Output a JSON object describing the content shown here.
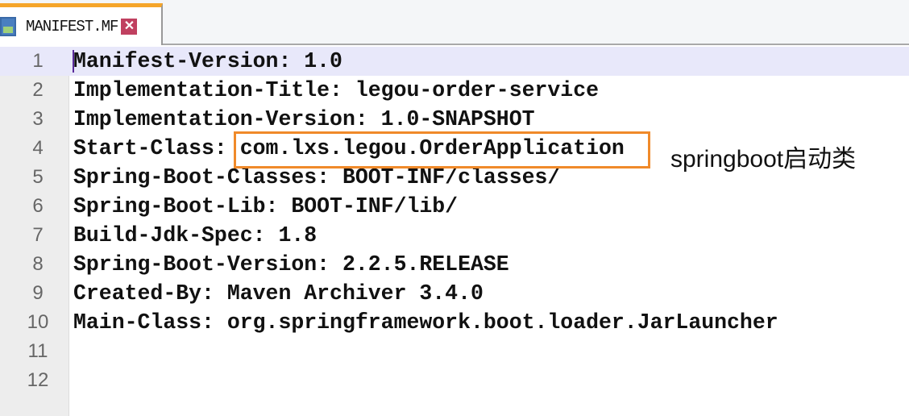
{
  "tab": {
    "title": "MANIFEST.MF",
    "close": "✕"
  },
  "lines": [
    {
      "n": "1",
      "text": "Manifest-Version: 1.0"
    },
    {
      "n": "2",
      "text": "Implementation-Title: legou-order-service"
    },
    {
      "n": "3",
      "text": "Implementation-Version: 1.0-SNAPSHOT"
    },
    {
      "n": "4",
      "text": "Start-Class: com.lxs.legou.OrderApplication"
    },
    {
      "n": "5",
      "text": "Spring-Boot-Classes: BOOT-INF/classes/"
    },
    {
      "n": "6",
      "text": "Spring-Boot-Lib: BOOT-INF/lib/"
    },
    {
      "n": "7",
      "text": "Build-Jdk-Spec: 1.8"
    },
    {
      "n": "8",
      "text": "Spring-Boot-Version: 2.2.5.RELEASE"
    },
    {
      "n": "9",
      "text": "Created-By: Maven Archiver 3.4.0"
    },
    {
      "n": "10",
      "text": "Main-Class: org.springframework.boot.loader.JarLauncher"
    },
    {
      "n": "11",
      "text": ""
    },
    {
      "n": "12",
      "text": ""
    }
  ],
  "annotation": "springboot启动类",
  "colors": {
    "highlight": "#f08a2a",
    "tab_accent": "#f5a52a"
  }
}
